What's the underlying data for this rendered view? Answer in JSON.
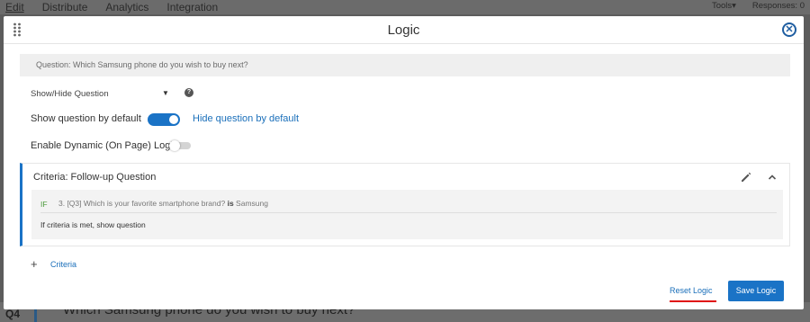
{
  "background": {
    "nav": [
      "Edit",
      "Distribute",
      "Analytics",
      "Integration"
    ],
    "tools_label": "Tools",
    "tools_caret": "▾",
    "responses_label": "Responses: 0",
    "question_number": "Q4",
    "question_text": "Which Samsung phone do you wish to buy next?"
  },
  "modal": {
    "title": "Logic",
    "close_glyph": "✕",
    "question_bar": "Question: Which Samsung phone do you wish to buy next?",
    "show_hide_select": "Show/Hide Question",
    "select_caret": "▼",
    "help_glyph": "?",
    "show_default_label": "Show question by default",
    "hide_default_label": "Hide question by default",
    "dynamic_logic_label": "Enable Dynamic (On Page) Logic",
    "criteria": {
      "title": "Criteria: Follow-up Question",
      "if_tag": "IF",
      "condition_text": "3. [Q3] Which is your favorite smartphone brand?",
      "condition_operator": "is",
      "condition_value": "Samsung",
      "action_text": "If criteria is met, show question"
    },
    "add_criteria_plus": "+",
    "add_criteria_label": "Criteria",
    "reset_label": "Reset Logic",
    "save_label": "Save Logic"
  },
  "colors": {
    "accent": "#1a73c6",
    "highlight_underline": "#e01010"
  }
}
